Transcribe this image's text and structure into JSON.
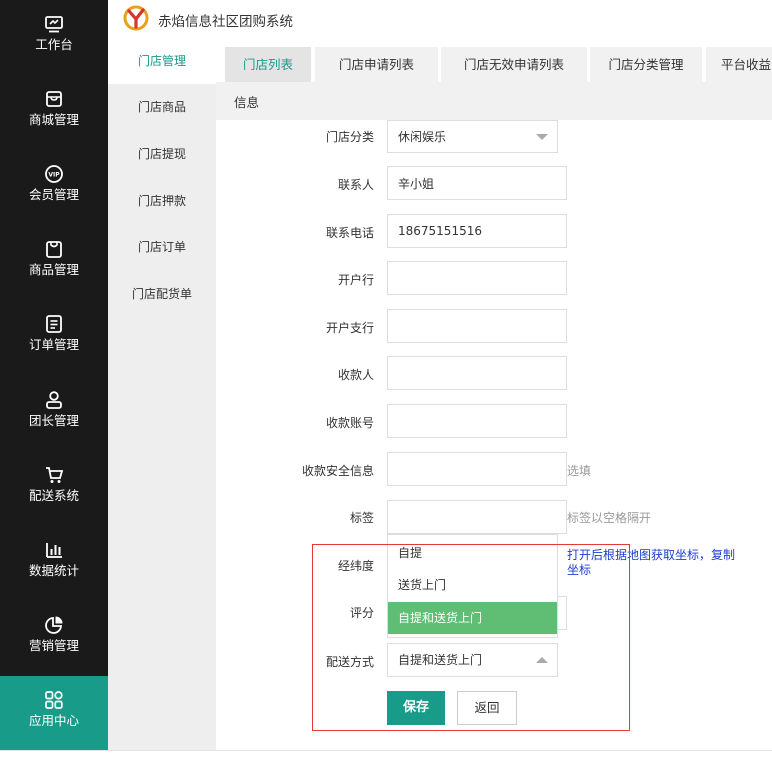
{
  "app": {
    "title": "赤焰信息社区团购系统"
  },
  "leftnav": [
    {
      "label": "工作台",
      "icon": "monitor-icon"
    },
    {
      "label": "商城管理",
      "icon": "store-icon"
    },
    {
      "label": "会员管理",
      "icon": "vip-icon"
    },
    {
      "label": "商品管理",
      "icon": "goods-icon"
    },
    {
      "label": "订单管理",
      "icon": "order-icon"
    },
    {
      "label": "团长管理",
      "icon": "leader-icon"
    },
    {
      "label": "配送系统",
      "icon": "cart-icon"
    },
    {
      "label": "数据统计",
      "icon": "bar-chart-icon"
    },
    {
      "label": "营销管理",
      "icon": "pie-chart-icon"
    },
    {
      "label": "应用中心",
      "icon": "apps-grid-icon",
      "active": true
    }
  ],
  "subnav": [
    {
      "label": "门店管理",
      "active": true
    },
    {
      "label": "门店商品"
    },
    {
      "label": "门店提现"
    },
    {
      "label": "门店押款"
    },
    {
      "label": "门店订单"
    },
    {
      "label": "门店配货单"
    }
  ],
  "tabs": [
    {
      "label": "门店列表",
      "active": true
    },
    {
      "label": "门店申请列表"
    },
    {
      "label": "门店无效申请列表"
    },
    {
      "label": "门店分类管理"
    },
    {
      "label": "平台收益"
    }
  ],
  "infobar": {
    "label": "信息"
  },
  "form": {
    "category": {
      "label": "门店分类",
      "value": "休闲娱乐"
    },
    "contact": {
      "label": "联系人",
      "value": "辛小姐"
    },
    "phone": {
      "label": "联系电话",
      "value": "18675151516"
    },
    "bank": {
      "label": "开户行",
      "value": ""
    },
    "branch": {
      "label": "开户支行",
      "value": ""
    },
    "payee": {
      "label": "收款人",
      "value": ""
    },
    "account": {
      "label": "收款账号",
      "value": ""
    },
    "security": {
      "label": "收款安全信息",
      "value": "",
      "hint": "选填"
    },
    "tags": {
      "label": "标签",
      "value": "",
      "hint": "标签以空格隔开"
    },
    "latlng": {
      "label": "经纬度",
      "hint": "打开后根据地图获取坐标，复制坐标"
    },
    "rating": {
      "label": "评分",
      "value": ""
    },
    "delivery": {
      "label": "配送方式",
      "value": "自提和送货上门"
    },
    "delivery_options": [
      "自提",
      "送货上门",
      "自提和送货上门"
    ],
    "save_label": "保存",
    "back_label": "返回"
  },
  "colors": {
    "accent": "#189b89",
    "selected_option": "#5fbd74",
    "highlight_border": "#e23a3a",
    "link": "#1c3fd0"
  }
}
